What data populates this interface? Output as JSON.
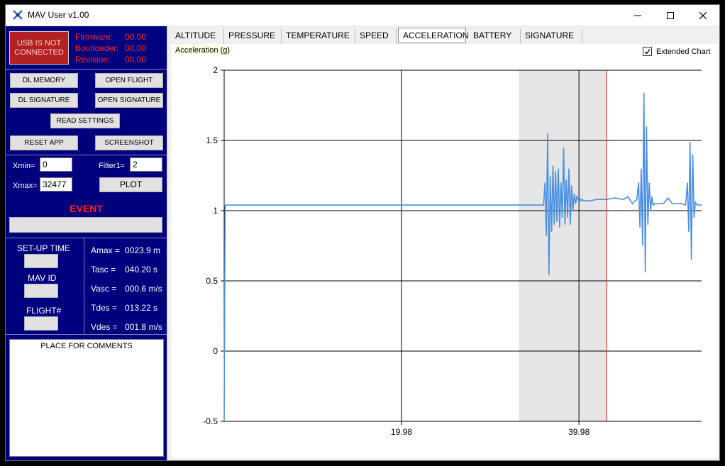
{
  "window": {
    "title": "MAV User v1.00"
  },
  "left": {
    "usb_status": "USB IS NOT CONNECTED",
    "firmware_label": "Firmware:",
    "firmware_value": "00.00",
    "bootloader_label": "Bootloader:",
    "bootloader_value": "00.00",
    "revision_label": "Revision:",
    "revision_value": "00.00",
    "buttons": {
      "dl_memory": "DL MEMORY",
      "open_flight": "OPEN FLIGHT",
      "dl_signature": "DL SIGNATURE",
      "open_signature": "OPEN SIGNATURE",
      "read_settings": "READ SETTINGS",
      "reset_app": "RESET APP",
      "screenshot": "SCREENSHOT",
      "plot": "PLOT"
    },
    "xmin_label": "Xmin=",
    "xmin_value": "0",
    "xmax_label": "Xmax=",
    "xmax_value": "32477",
    "filter_label": "Filter1=",
    "filter_value": "2",
    "event_label": "EVENT",
    "setup_time_label": "SET-UP TIME",
    "mav_id_label": "MAV ID",
    "flight_label": "FLIGHT#",
    "stats": [
      {
        "label": "Amax =",
        "value": "0023.9 m"
      },
      {
        "label": "Tasc =",
        "value": "040.20 s"
      },
      {
        "label": "Vasc =",
        "value": "000.6 m/s"
      },
      {
        "label": "Tdes =",
        "value": "013.22 s"
      },
      {
        "label": "Vdes =",
        "value": "001.8 m/s"
      }
    ],
    "comments_label": "PLACE FOR COMMENTS"
  },
  "tabs": [
    {
      "label": "ALTITUDE",
      "active": false
    },
    {
      "label": "PRESSURE",
      "active": false
    },
    {
      "label": "TEMPERATURE",
      "active": false
    },
    {
      "label": "SPEED",
      "active": false
    },
    {
      "label": "ACCELERATION",
      "active": true
    },
    {
      "label": "BATTERY",
      "active": false
    },
    {
      "label": "SIGNATURE",
      "active": false
    }
  ],
  "chart": {
    "extended_label": "Extended Chart",
    "extended_checked": true
  },
  "chart_data": {
    "type": "line",
    "title": "",
    "ylabel": "Acceleration (g)",
    "xlabel": "",
    "ylim": [
      -0.5,
      2
    ],
    "yticks": [
      -0.5,
      0,
      0.5,
      1,
      1.5,
      2
    ],
    "xlim": [
      0,
      53.8
    ],
    "xticks": [
      19.98,
      39.98
    ],
    "grid": true,
    "series_color": "#4a90e2",
    "highlight_range": [
      33.2,
      43.1
    ],
    "highlight_color": "#e6e6e6",
    "marker_line": 43.1,
    "marker_color": "#e01b1b",
    "series": [
      {
        "x": [
          0,
          0.1,
          0.15,
          1,
          5,
          10,
          15,
          20,
          25,
          30,
          33,
          36,
          36.15,
          36.3,
          36.45,
          36.6,
          36.75,
          36.9,
          37.05,
          37.2,
          37.35,
          37.5,
          37.65,
          37.8,
          37.95,
          38.1,
          38.25,
          38.4,
          38.55,
          38.7,
          38.85,
          39.0,
          39.15,
          39.3,
          39.45,
          39.6,
          39.75,
          39.9,
          40.05,
          40.2,
          40.35,
          40.5,
          40.8,
          41.2,
          42,
          43,
          44,
          45,
          45.5,
          46,
          46.5,
          46.7,
          46.85,
          47.0,
          47.15,
          47.3,
          47.45,
          47.6,
          47.75,
          47.9,
          48.05,
          48.2,
          48.35,
          48.5,
          48.8,
          49.5,
          50,
          50.5,
          51.5,
          52,
          52.2,
          52.35,
          52.5,
          52.65,
          52.8,
          52.95,
          53.1,
          53.3,
          53.8
        ],
        "y": [
          -0.5,
          1.03,
          1.04,
          1.04,
          1.04,
          1.04,
          1.04,
          1.04,
          1.04,
          1.04,
          1.04,
          1.04,
          1.2,
          0.82,
          1.55,
          0.54,
          1.25,
          0.85,
          1.32,
          0.9,
          1.28,
          0.92,
          1.3,
          0.88,
          1.2,
          0.95,
          1.45,
          0.9,
          1.22,
          0.95,
          1.3,
          0.9,
          1.18,
          1.0,
          1.12,
          1.05,
          1.1,
          1.08,
          1.09,
          1.07,
          1.08,
          1.07,
          1.07,
          1.07,
          1.08,
          1.08,
          1.09,
          1.08,
          1.1,
          1.05,
          1.08,
          1.2,
          0.88,
          1.3,
          0.75,
          1.84,
          0.56,
          1.6,
          0.9,
          1.2,
          1.0,
          1.1,
          1.04,
          1.05,
          1.05,
          1.05,
          1.09,
          1.05,
          1.05,
          1.04,
          1.2,
          0.85,
          1.49,
          0.65,
          1.4,
          0.95,
          1.06,
          1.04,
          1.04
        ]
      }
    ]
  }
}
